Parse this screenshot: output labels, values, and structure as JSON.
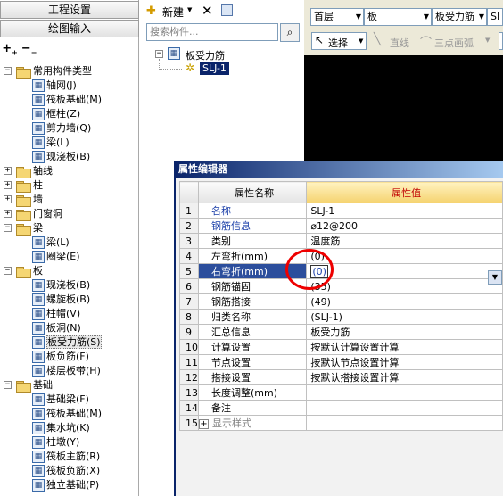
{
  "nav": {
    "btn1": "工程设置",
    "btn2": "绘图输入"
  },
  "tree": {
    "items": [
      {
        "label": "常用构件类型",
        "icon": "folder-icon",
        "open": true
      },
      {
        "label": "轴网(J)",
        "icon": "grid-icon"
      },
      {
        "label": "筏板基础(M)",
        "icon": "raft-icon"
      },
      {
        "label": "框柱(Z)",
        "icon": "column-icon"
      },
      {
        "label": "剪力墙(Q)",
        "icon": "wall-icon"
      },
      {
        "label": "梁(L)",
        "icon": "beam-icon"
      },
      {
        "label": "现浇板(B)",
        "icon": "slab-icon"
      },
      {
        "label": "轴线",
        "icon": "folder-icon"
      },
      {
        "label": "柱",
        "icon": "folder-icon"
      },
      {
        "label": "墙",
        "icon": "folder-icon"
      },
      {
        "label": "门窗洞",
        "icon": "folder-icon"
      },
      {
        "label": "梁",
        "icon": "folder-icon",
        "open": true
      },
      {
        "label": "梁(L)",
        "icon": "beam-icon"
      },
      {
        "label": "圈梁(E)",
        "icon": "ringbeam-icon"
      },
      {
        "label": "板",
        "icon": "folder-icon",
        "open": true
      },
      {
        "label": "现浇板(B)",
        "icon": "slab-icon"
      },
      {
        "label": "螺旋板(B)",
        "icon": "spiral-icon"
      },
      {
        "label": "柱帽(V)",
        "icon": "capital-icon"
      },
      {
        "label": "板洞(N)",
        "icon": "hole-icon"
      },
      {
        "label": "板受力筋(S)",
        "icon": "rebar-icon",
        "selected": true
      },
      {
        "label": "板负筋(F)",
        "icon": "negrebar-icon"
      },
      {
        "label": "楼层板带(H)",
        "icon": "strip-icon"
      },
      {
        "label": "基础",
        "icon": "folder-icon",
        "open": true
      },
      {
        "label": "基础梁(F)",
        "icon": "foundbeam-icon"
      },
      {
        "label": "筏板基础(M)",
        "icon": "raft-icon"
      },
      {
        "label": "集水坑(K)",
        "icon": "sump-icon"
      },
      {
        "label": "柱墩(Y)",
        "icon": "pier-icon"
      },
      {
        "label": "筏板主筋(R)",
        "icon": "mainrebar-icon"
      },
      {
        "label": "筏板负筋(X)",
        "icon": "raftneg-icon"
      },
      {
        "label": "独立基础(P)",
        "icon": "isolated-icon"
      }
    ]
  },
  "mid": {
    "new_label": "新建",
    "search_placeholder": "搜索构件...",
    "root": "板受力筋",
    "child": "SLJ-1"
  },
  "toolbar": {
    "floor": "首层",
    "type": "板",
    "sub": "板受力筋",
    "extra": "SI",
    "select": "选择",
    "line": "直线",
    "arc": "三点画弧"
  },
  "prop": {
    "title": "属性编辑器",
    "col_name": "属性名称",
    "col_value": "属性值",
    "rows": [
      {
        "n": "1",
        "name": "名称",
        "value": "SLJ-1",
        "blue": true
      },
      {
        "n": "2",
        "name": "钢筋信息",
        "value": "⌀12@200",
        "blue": true
      },
      {
        "n": "3",
        "name": "类别",
        "value": "温度筋"
      },
      {
        "n": "4",
        "name": "左弯折(mm)",
        "value": "(0)"
      },
      {
        "n": "5",
        "name": "右弯折(mm)",
        "value": "(0)",
        "selected": true
      },
      {
        "n": "6",
        "name": "钢筋锚固",
        "value": "(35)"
      },
      {
        "n": "7",
        "name": "钢筋搭接",
        "value": "(49)"
      },
      {
        "n": "8",
        "name": "归类名称",
        "value": "(SLJ-1)"
      },
      {
        "n": "9",
        "name": "汇总信息",
        "value": "板受力筋"
      },
      {
        "n": "10",
        "name": "计算设置",
        "value": "按默认计算设置计算"
      },
      {
        "n": "11",
        "name": "节点设置",
        "value": "按默认节点设置计算"
      },
      {
        "n": "12",
        "name": "搭接设置",
        "value": "按默认搭接设置计算"
      },
      {
        "n": "13",
        "name": "长度调整(mm)",
        "value": ""
      },
      {
        "n": "14",
        "name": "备注",
        "value": ""
      },
      {
        "n": "15",
        "name": "显示样式",
        "value": "",
        "expand": true
      }
    ]
  }
}
